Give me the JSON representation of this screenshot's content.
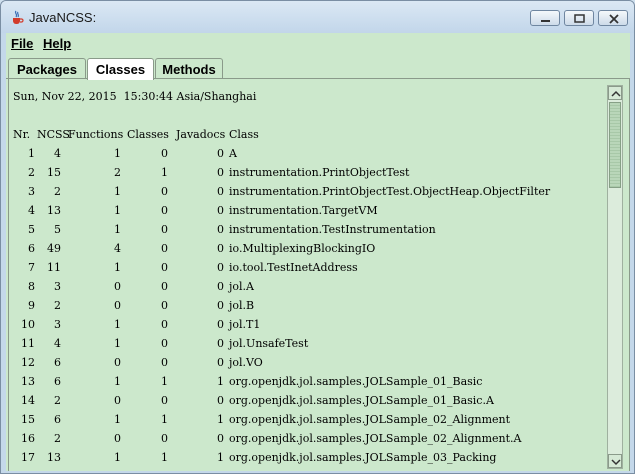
{
  "window": {
    "title": "JavaNCSS:"
  },
  "menu": [
    {
      "label": "File"
    },
    {
      "label": "Help"
    }
  ],
  "tabs": [
    {
      "label": "Packages"
    },
    {
      "label": "Classes"
    },
    {
      "label": "Methods"
    }
  ],
  "content": {
    "date": "Sun, Nov 22, 2015  15:30:44 Asia/Shanghai",
    "headers": {
      "nr": "Nr.",
      "ncss": "NCSS",
      "functions": "Functions",
      "classes": "Classes",
      "javadocs": "Javadocs",
      "cls": "Class"
    },
    "rows": [
      {
        "nr": "1",
        "ncss": "4",
        "functions": "1",
        "classes": "0",
        "javadocs": "0",
        "cls": "A"
      },
      {
        "nr": "2",
        "ncss": "15",
        "functions": "2",
        "classes": "1",
        "javadocs": "0",
        "cls": "instrumentation.PrintObjectTest"
      },
      {
        "nr": "3",
        "ncss": "2",
        "functions": "1",
        "classes": "0",
        "javadocs": "0",
        "cls": "instrumentation.PrintObjectTest.ObjectHeap.ObjectFilter"
      },
      {
        "nr": "4",
        "ncss": "13",
        "functions": "1",
        "classes": "0",
        "javadocs": "0",
        "cls": "instrumentation.TargetVM"
      },
      {
        "nr": "5",
        "ncss": "5",
        "functions": "1",
        "classes": "0",
        "javadocs": "0",
        "cls": "instrumentation.TestInstrumentation"
      },
      {
        "nr": "6",
        "ncss": "49",
        "functions": "4",
        "classes": "0",
        "javadocs": "0",
        "cls": "io.MultiplexingBlockingIO"
      },
      {
        "nr": "7",
        "ncss": "11",
        "functions": "1",
        "classes": "0",
        "javadocs": "0",
        "cls": "io.tool.TestInetAddress"
      },
      {
        "nr": "8",
        "ncss": "3",
        "functions": "0",
        "classes": "0",
        "javadocs": "0",
        "cls": "jol.A"
      },
      {
        "nr": "9",
        "ncss": "2",
        "functions": "0",
        "classes": "0",
        "javadocs": "0",
        "cls": "jol.B"
      },
      {
        "nr": "10",
        "ncss": "3",
        "functions": "1",
        "classes": "0",
        "javadocs": "0",
        "cls": "jol.T1"
      },
      {
        "nr": "11",
        "ncss": "4",
        "functions": "1",
        "classes": "0",
        "javadocs": "0",
        "cls": "jol.UnsafeTest"
      },
      {
        "nr": "12",
        "ncss": "6",
        "functions": "0",
        "classes": "0",
        "javadocs": "0",
        "cls": "jol.VO"
      },
      {
        "nr": "13",
        "ncss": "6",
        "functions": "1",
        "classes": "1",
        "javadocs": "1",
        "cls": "org.openjdk.jol.samples.JOLSample_01_Basic"
      },
      {
        "nr": "14",
        "ncss": "2",
        "functions": "0",
        "classes": "0",
        "javadocs": "0",
        "cls": "org.openjdk.jol.samples.JOLSample_01_Basic.A"
      },
      {
        "nr": "15",
        "ncss": "6",
        "functions": "1",
        "classes": "1",
        "javadocs": "1",
        "cls": "org.openjdk.jol.samples.JOLSample_02_Alignment"
      },
      {
        "nr": "16",
        "ncss": "2",
        "functions": "0",
        "classes": "0",
        "javadocs": "0",
        "cls": "org.openjdk.jol.samples.JOLSample_02_Alignment.A"
      },
      {
        "nr": "17",
        "ncss": "13",
        "functions": "1",
        "classes": "1",
        "javadocs": "1",
        "cls": "org.openjdk.jol.samples.JOLSample_03_Packing"
      }
    ]
  }
}
